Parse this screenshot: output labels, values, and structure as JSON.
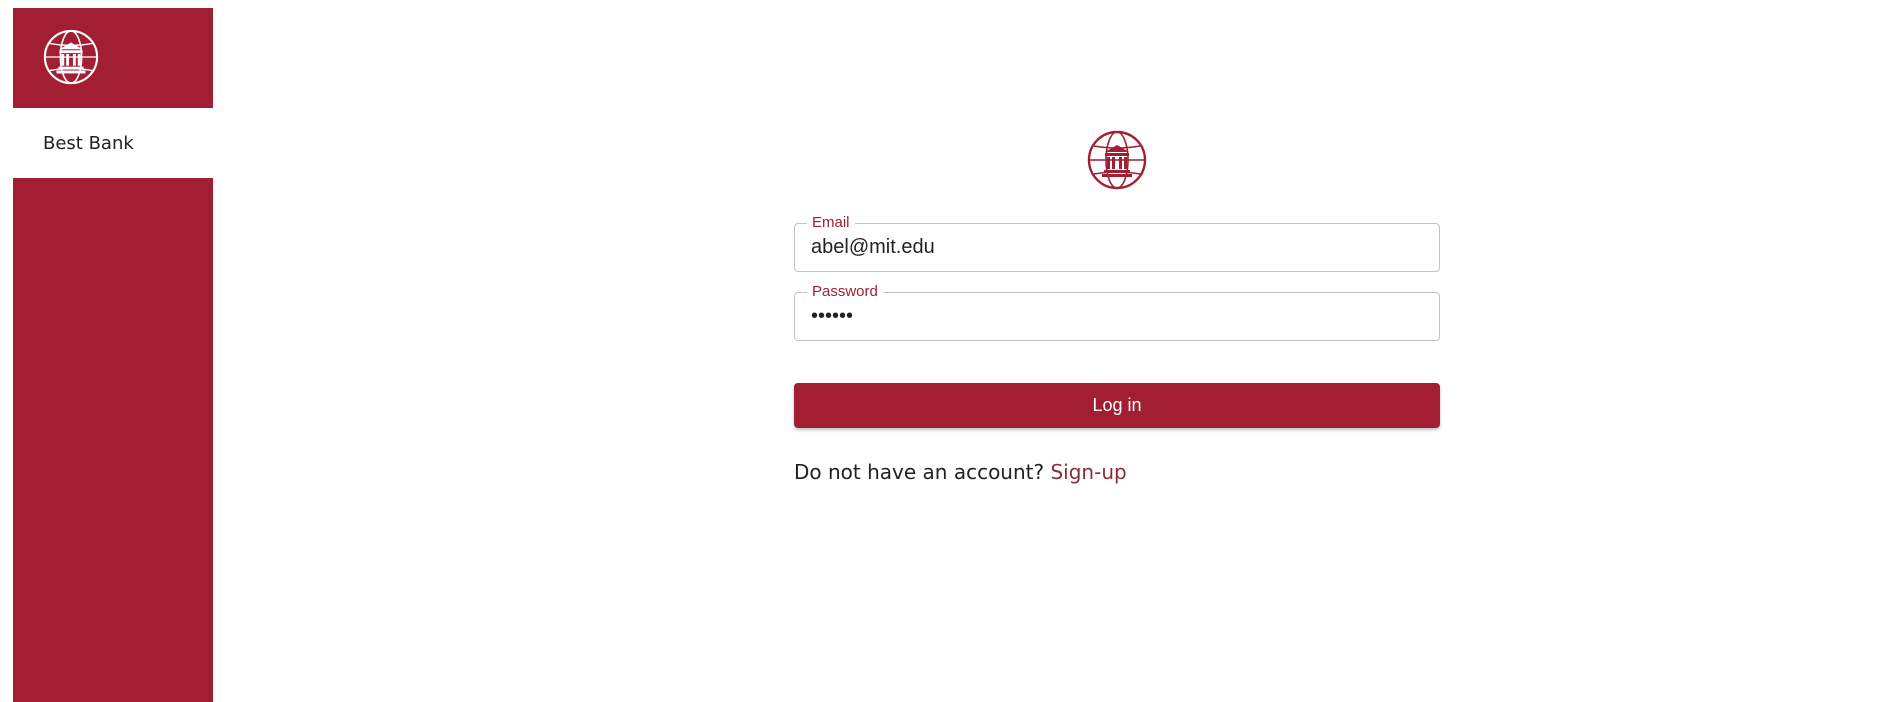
{
  "sidebar": {
    "logo_icon": "bank-globe-icon",
    "brand_label": "Best Bank",
    "color": "#a21e33"
  },
  "login_form": {
    "logo_icon": "bank-globe-icon",
    "email": {
      "label": "Email",
      "value": "abel@mit.edu"
    },
    "password": {
      "label": "Password",
      "value": "••••••"
    },
    "login_button_label": "Log in",
    "signup_prompt": "Do not have an account?",
    "signup_link": "Sign-up"
  },
  "colors": {
    "accent": "#a21e33",
    "link": "#8d2b3c"
  }
}
